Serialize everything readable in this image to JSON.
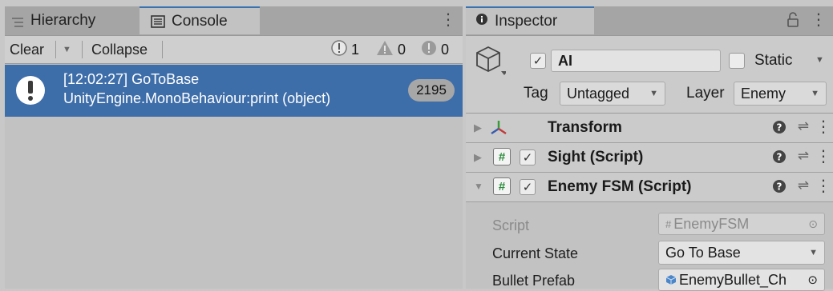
{
  "left_panel": {
    "tabs": {
      "hierarchy": "Hierarchy",
      "console": "Console"
    },
    "toolbar": {
      "clear": "Clear",
      "collapse": "Collapse"
    },
    "counters": {
      "info": "1",
      "warning": "0",
      "error": "0"
    },
    "entry": {
      "line1": "[12:02:27] GoToBase",
      "line2": "UnityEngine.MonoBehaviour:print (object)",
      "count": "2195"
    }
  },
  "inspector": {
    "tab": "Inspector",
    "object": {
      "name": "AI",
      "static_label": "Static",
      "tag_label": "Tag",
      "tag_value": "Untagged",
      "layer_label": "Layer",
      "layer_value": "Enemy"
    },
    "components": {
      "transform": "Transform",
      "sight": "Sight (Script)",
      "enemy_fsm": "Enemy FSM (Script)"
    },
    "properties": {
      "script_label": "Script",
      "script_value": "EnemyFSM",
      "current_state_label": "Current State",
      "current_state_value": "Go To Base",
      "bullet_prefab_label": "Bullet Prefab",
      "bullet_prefab_value": "EnemyBullet_Ch"
    }
  },
  "colors": {
    "selection": "#3e6ea9",
    "accent": "#3a72b0"
  }
}
